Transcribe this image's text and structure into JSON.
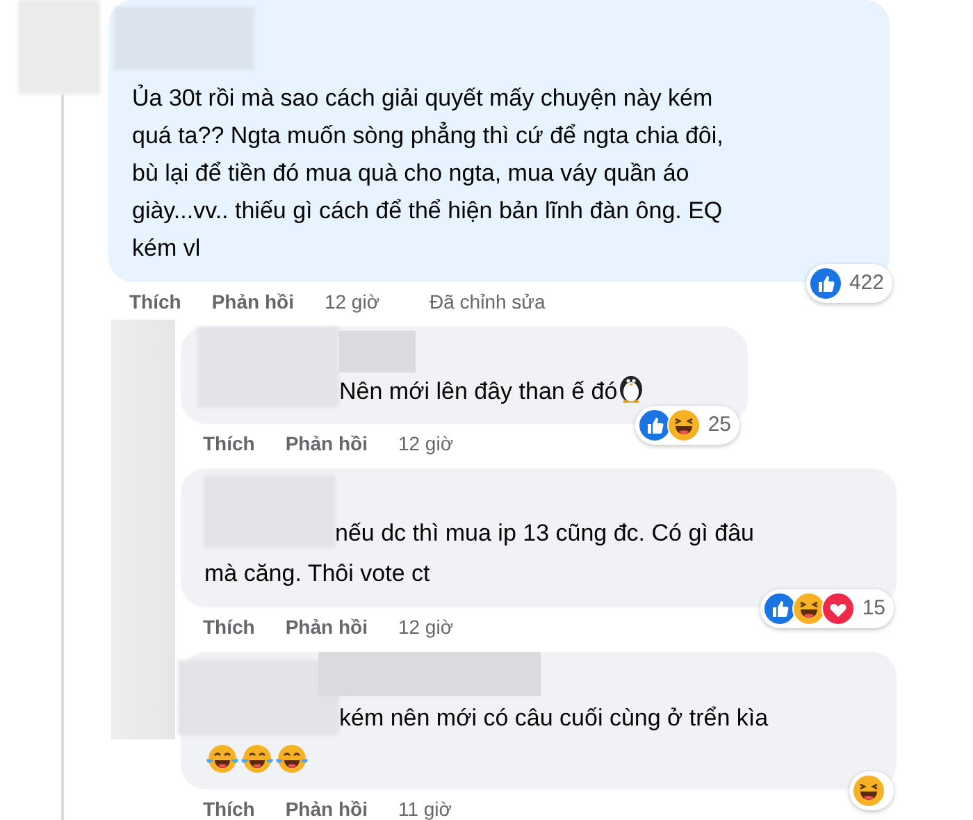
{
  "comment": {
    "text": "Ủa 30t rồi mà sao cách giải quyết mấy chuyện này kém\nquá ta?? Ngta muốn sòng phẳng thì cứ để ngta chia đôi,\nbù lại để tiền đó mua quà cho ngta, mua váy quần áo\ngiày...vv.. thiếu gì cách để thể hiện bản lĩnh đàn ông. EQ\nkém vl",
    "reactions": {
      "icons": [
        {
          "kind": "like"
        }
      ],
      "count": "422"
    },
    "actions": [
      {
        "label": "Thích"
      },
      {
        "label": "Phản hồi"
      }
    ],
    "time": "12 giờ",
    "edited": "Đã chỉnh sửa"
  },
  "replies": [
    {
      "text": "Nên mới lên đây than ế đó",
      "inline_emoji": [
        {
          "kind": "penguin"
        }
      ],
      "reactions": {
        "icons": [
          {
            "kind": "like"
          },
          {
            "kind": "haha"
          }
        ],
        "count": "25"
      },
      "actions": [
        {
          "label": "Thích"
        },
        {
          "label": "Phản hồi"
        }
      ],
      "time": "12 giờ"
    },
    {
      "text": "nếu dc thì mua ip 13 cũng đc. Có gì đâu\nmà căng. Thôi vote ct",
      "reactions": {
        "icons": [
          {
            "kind": "like"
          },
          {
            "kind": "haha"
          },
          {
            "kind": "love"
          }
        ],
        "count": "15"
      },
      "actions": [
        {
          "label": "Thích"
        },
        {
          "label": "Phản hồi"
        }
      ],
      "time": "12 giờ"
    },
    {
      "text": "kém nên mới có câu cuối cùng ở trển kìa",
      "emoji_line": [
        {
          "kind": "tears-of-joy"
        },
        {
          "kind": "tears-of-joy"
        },
        {
          "kind": "tears-of-joy"
        }
      ],
      "reactions": {
        "icons": [
          {
            "kind": "haha"
          }
        ]
      },
      "actions": [
        {
          "label": "Thích"
        },
        {
          "label": "Phản hồi"
        }
      ],
      "time": "11 giờ"
    }
  ]
}
